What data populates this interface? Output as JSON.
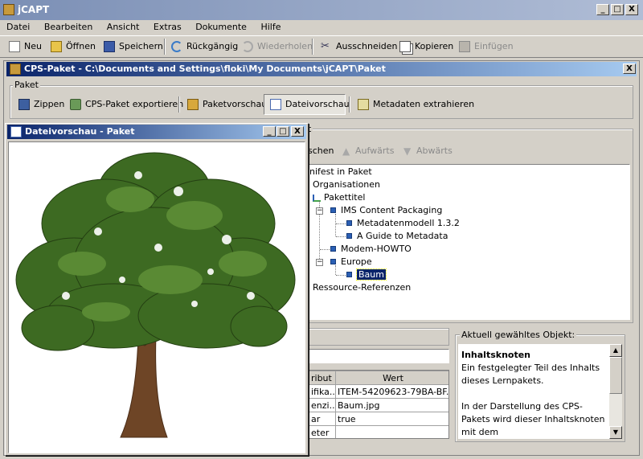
{
  "app": {
    "title": "jCAPT",
    "window_buttons": [
      "_",
      "□",
      "X"
    ]
  },
  "menubar": [
    "Datei",
    "Bearbeiten",
    "Ansicht",
    "Extras",
    "Dokumente",
    "Hilfe"
  ],
  "toolbar": {
    "new": "Neu",
    "open": "Öffnen",
    "save": "Speichern",
    "undo": "Rückgängig",
    "redo": "Wiederholen",
    "cut": "Ausschneiden",
    "copy": "Kopieren",
    "paste": "Einfügen"
  },
  "package_window": {
    "title": "CPS-Paket - C:\\Documents and Settings\\floki\\My Documents\\jCAPT\\Paket",
    "close": "X",
    "group_label": "Paket",
    "buttons": {
      "zip": "Zippen",
      "export": "CPS-Paket exportieren",
      "preview": "Paketvorschau",
      "file_preview": "Dateivorschau",
      "metadata": "Metadaten extrahieren"
    }
  },
  "structure_panel": {
    "label_tail": "t",
    "actions": {
      "delete_tail": "schen",
      "up": "Aufwärts",
      "down": "Abwärts"
    },
    "tree": {
      "root": "nifest in Paket",
      "organisations": "Organisationen",
      "title": "Pakettitel",
      "ims": "IMS Content Packaging",
      "metamodel": "Metadatenmodell 1.3.2",
      "guide": "A Guide to Metadata",
      "modem": "Modem-HOWTO",
      "europe": "Europe",
      "baum": "Baum",
      "resources": "Ressource-Referenzen"
    }
  },
  "properties": {
    "headers": [
      "ribut",
      "Wert"
    ],
    "rows": [
      [
        "ifika...",
        "ITEM-54209623-79BA-BF..."
      ],
      [
        "enzi...",
        "Baum.jpg"
      ],
      [
        "ar",
        "true"
      ],
      [
        "eter",
        ""
      ]
    ]
  },
  "info_panel": {
    "legend": "Aktuell gewähltes Objekt:",
    "heading": "Inhaltsknoten",
    "paragraph1": "Ein festgelegter Teil des Inhalts dieses Lernpakets.",
    "paragraph2": "In der Darstellung des CPS-Pakets wird dieser Inhaltsknoten mit dem"
  },
  "preview_window": {
    "title": "Dateivorschau - Paket",
    "buttons": [
      "_",
      "□",
      "X"
    ]
  },
  "colors": {
    "desktop": "#d4d0c8",
    "selection": "#0a246a",
    "tree_node": "#2b5fb4",
    "leaf_green": "#3d6a22",
    "trunk_brown": "#6e4526"
  }
}
